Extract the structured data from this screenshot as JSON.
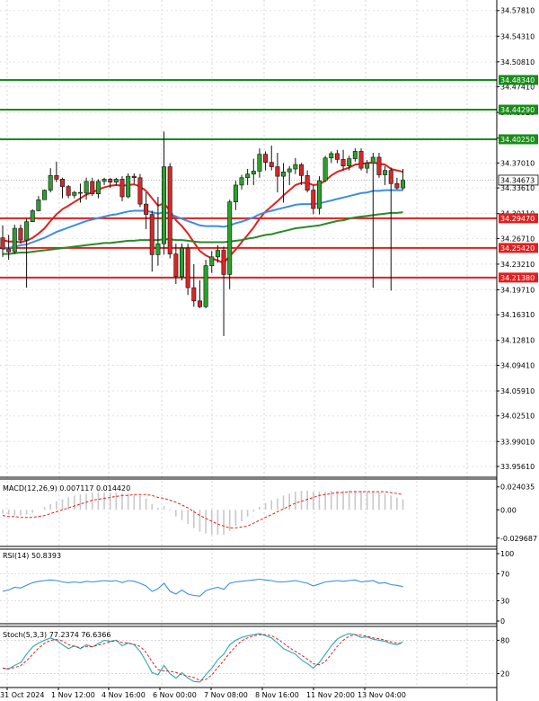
{
  "chart_data": {
    "type": "candlestick",
    "x_ticks": [
      "31 Oct 2024",
      "1 Nov 12:00",
      "4 Nov 16:00",
      "6 Nov 00:00",
      "7 Nov 08:00",
      "8 Nov 16:00",
      "11 Nov 20:00",
      "13 Nov 04:00"
    ],
    "price_axis": {
      "ylim": [
        33.9414,
        34.5925
      ],
      "ticks": [
        "34.57810",
        "34.54310",
        "34.50810",
        "34.47410",
        "34.43910",
        "34.40410",
        "34.37010",
        "34.33610",
        "34.30110",
        "34.26710",
        "34.23210",
        "34.19710",
        "34.16310",
        "34.12810",
        "34.09410",
        "34.05910",
        "34.02510",
        "33.99010",
        "33.95610"
      ]
    },
    "current_price": {
      "value": 34.34673,
      "label": "34.34673"
    },
    "levels": [
      {
        "value": 34.4834,
        "label": "34.48340",
        "role": "resistance",
        "color": "#1a8c1a"
      },
      {
        "value": 34.4429,
        "label": "34.44290",
        "role": "resistance",
        "color": "#1a8c1a"
      },
      {
        "value": 34.4025,
        "label": "34.40250",
        "role": "resistance",
        "color": "#1a8c1a"
      },
      {
        "value": 34.2947,
        "label": "34.29470",
        "role": "support",
        "color": "#e02020"
      },
      {
        "value": 34.2542,
        "label": "34.25420",
        "role": "support",
        "color": "#e02020"
      },
      {
        "value": 34.2138,
        "label": "34.21380",
        "role": "support",
        "color": "#e02020"
      }
    ],
    "candles": [
      [
        34.268,
        34.285,
        34.242,
        34.253
      ],
      [
        34.253,
        34.272,
        34.238,
        34.249
      ],
      [
        34.249,
        34.286,
        34.246,
        34.281
      ],
      [
        34.281,
        34.286,
        34.26,
        34.265
      ],
      [
        34.265,
        34.294,
        34.2,
        34.29
      ],
      [
        34.29,
        34.307,
        34.29,
        34.305
      ],
      [
        34.305,
        34.325,
        34.304,
        34.32
      ],
      [
        34.32,
        34.334,
        34.32,
        34.333
      ],
      [
        34.333,
        34.363,
        34.33,
        34.353
      ],
      [
        34.353,
        34.372,
        34.344,
        34.348
      ],
      [
        34.348,
        34.35,
        34.322,
        34.338
      ],
      [
        34.338,
        34.34,
        34.322,
        34.326
      ],
      [
        34.326,
        34.332,
        34.322,
        34.33
      ],
      [
        34.33,
        34.342,
        34.316,
        34.329
      ],
      [
        34.329,
        34.35,
        34.32,
        34.345
      ],
      [
        34.345,
        34.35,
        34.325,
        34.328
      ],
      [
        34.328,
        34.348,
        34.322,
        34.345
      ],
      [
        34.345,
        34.35,
        34.34,
        34.348
      ],
      [
        34.348,
        34.35,
        34.336,
        34.344
      ],
      [
        34.344,
        34.35,
        34.34,
        34.348
      ],
      [
        34.348,
        34.352,
        34.318,
        34.324
      ],
      [
        34.324,
        34.356,
        34.322,
        34.352
      ],
      [
        34.352,
        34.356,
        34.342,
        34.35
      ],
      [
        34.35,
        34.355,
        34.31,
        34.314
      ],
      [
        34.314,
        34.33,
        34.28,
        34.3
      ],
      [
        34.3,
        34.305,
        34.222,
        34.245
      ],
      [
        34.245,
        34.324,
        34.23,
        34.26
      ],
      [
        34.26,
        34.413,
        34.245,
        34.365
      ],
      [
        34.365,
        34.37,
        34.24,
        34.246
      ],
      [
        34.246,
        34.26,
        34.205,
        34.215
      ],
      [
        34.215,
        34.26,
        34.21,
        34.254
      ],
      [
        34.254,
        34.26,
        34.19,
        34.2
      ],
      [
        34.2,
        34.232,
        34.174,
        34.182
      ],
      [
        34.182,
        34.21,
        34.172,
        34.174
      ],
      [
        34.174,
        34.238,
        34.172,
        34.23
      ],
      [
        34.23,
        34.25,
        34.22,
        34.242
      ],
      [
        34.242,
        34.258,
        34.234,
        34.251
      ],
      [
        34.251,
        34.256,
        34.134,
        34.218
      ],
      [
        34.218,
        34.32,
        34.198,
        34.317
      ],
      [
        34.317,
        34.346,
        34.306,
        34.34
      ],
      [
        34.34,
        34.354,
        34.334,
        34.35
      ],
      [
        34.35,
        34.362,
        34.34,
        34.355
      ],
      [
        34.355,
        34.376,
        34.34,
        34.359
      ],
      [
        34.359,
        34.39,
        34.35,
        34.382
      ],
      [
        34.382,
        34.386,
        34.36,
        34.371
      ],
      [
        34.371,
        34.394,
        34.36,
        34.365
      ],
      [
        34.365,
        34.384,
        34.33,
        34.352
      ],
      [
        34.352,
        34.37,
        34.316,
        34.358
      ],
      [
        34.358,
        34.366,
        34.34,
        34.362
      ],
      [
        34.362,
        34.377,
        34.355,
        34.368
      ],
      [
        34.368,
        34.37,
        34.34,
        34.353
      ],
      [
        34.353,
        34.36,
        34.33,
        34.333
      ],
      [
        34.333,
        34.34,
        34.3,
        34.308
      ],
      [
        34.308,
        34.352,
        34.3,
        34.346
      ],
      [
        34.346,
        34.38,
        34.344,
        34.377
      ],
      [
        34.377,
        34.386,
        34.37,
        34.383
      ],
      [
        34.383,
        34.388,
        34.37,
        34.375
      ],
      [
        34.375,
        34.388,
        34.36,
        34.366
      ],
      [
        34.366,
        34.38,
        34.36,
        34.376
      ],
      [
        34.376,
        34.39,
        34.372,
        34.386
      ],
      [
        34.386,
        34.39,
        34.36,
        34.363
      ],
      [
        34.363,
        34.374,
        34.356,
        34.37
      ],
      [
        34.37,
        34.384,
        34.2,
        34.378
      ],
      [
        34.378,
        34.384,
        34.35,
        34.354
      ],
      [
        34.354,
        34.366,
        34.34,
        34.36
      ],
      [
        34.36,
        34.364,
        34.196,
        34.342
      ],
      [
        34.342,
        34.35,
        34.334,
        34.336
      ],
      [
        34.336,
        34.362,
        34.333,
        34.347
      ]
    ],
    "moving_averages": [
      {
        "color": "#e02020",
        "values": [
          34.265,
          34.263,
          34.263,
          34.262,
          34.264,
          34.268,
          34.274,
          34.281,
          34.291,
          34.3,
          34.307,
          34.312,
          34.317,
          34.322,
          34.327,
          34.33,
          34.334,
          34.337,
          34.339,
          34.34,
          34.339,
          34.34,
          34.341,
          34.338,
          34.332,
          34.322,
          34.312,
          34.315,
          34.305,
          34.292,
          34.284,
          34.274,
          34.262,
          34.25,
          34.244,
          34.24,
          34.237,
          34.234,
          34.243,
          34.252,
          34.262,
          34.272,
          34.282,
          34.294,
          34.304,
          34.311,
          34.318,
          34.326,
          34.333,
          34.34,
          34.343,
          34.343,
          34.34,
          34.341,
          34.346,
          34.353,
          34.358,
          34.361,
          34.364,
          34.368,
          34.369,
          34.37,
          34.371,
          34.369,
          34.368,
          34.362,
          34.36,
          34.358
        ]
      },
      {
        "color": "#3b8fe0",
        "values": [
          34.253,
          34.254,
          34.256,
          34.258,
          34.259,
          34.262,
          34.265,
          34.268,
          34.272,
          34.276,
          34.279,
          34.282,
          34.285,
          34.288,
          34.291,
          34.293,
          34.295,
          34.297,
          34.299,
          34.3,
          34.302,
          34.304,
          34.305,
          34.305,
          34.305,
          34.303,
          34.301,
          34.303,
          34.301,
          34.297,
          34.294,
          34.291,
          34.288,
          34.285,
          34.284,
          34.284,
          34.284,
          34.283,
          34.285,
          34.288,
          34.29,
          34.293,
          34.296,
          34.3,
          34.303,
          34.305,
          34.307,
          34.309,
          34.311,
          34.313,
          34.314,
          34.314,
          34.314,
          34.315,
          34.317,
          34.319,
          34.321,
          34.323,
          34.325,
          34.327,
          34.329,
          34.33,
          34.332,
          34.332,
          34.333,
          34.333,
          34.333,
          34.333
        ]
      },
      {
        "color": "#2a8a2a",
        "values": [
          34.246,
          34.246,
          34.247,
          34.248,
          34.248,
          34.249,
          34.25,
          34.251,
          34.252,
          34.253,
          34.254,
          34.255,
          34.256,
          34.257,
          34.258,
          34.259,
          34.26,
          34.261,
          34.261,
          34.262,
          34.263,
          34.264,
          34.264,
          34.265,
          34.265,
          34.265,
          34.265,
          34.266,
          34.266,
          34.265,
          34.265,
          34.264,
          34.263,
          34.262,
          34.262,
          34.262,
          34.262,
          34.262,
          34.263,
          34.264,
          34.265,
          34.267,
          34.268,
          34.27,
          34.272,
          34.273,
          34.275,
          34.277,
          34.279,
          34.281,
          34.282,
          34.283,
          34.284,
          34.285,
          34.287,
          34.289,
          34.291,
          34.292,
          34.294,
          34.296,
          34.297,
          34.298,
          34.299,
          34.3,
          34.301,
          34.302,
          34.302,
          34.303
        ]
      }
    ],
    "macd": {
      "label": "MACD(12,26,9) 0.007117 0.014420",
      "ylim": [
        -0.0365,
        0.0285
      ],
      "ticks": [
        "0.024035",
        "0.00",
        "-0.029687"
      ],
      "histogram": [
        -0.004,
        -0.005,
        -0.006,
        -0.006,
        -0.005,
        -0.003,
        0,
        0.003,
        0.006,
        0.009,
        0.011,
        0.013,
        0.015,
        0.016,
        0.017,
        0.018,
        0.018,
        0.018,
        0.018,
        0.018,
        0.017,
        0.017,
        0.016,
        0.015,
        0.012,
        0.006,
        0.002,
        0.004,
        -0.001,
        -0.007,
        -0.011,
        -0.015,
        -0.019,
        -0.023,
        -0.025,
        -0.026,
        -0.026,
        -0.026,
        -0.022,
        -0.017,
        -0.012,
        -0.007,
        -0.002,
        0.003,
        0.007,
        0.01,
        0.012,
        0.015,
        0.017,
        0.019,
        0.02,
        0.02,
        0.019,
        0.019,
        0.019,
        0.02,
        0.02,
        0.02,
        0.02,
        0.02,
        0.02,
        0.019,
        0.019,
        0.018,
        0.017,
        0.015,
        0.013,
        0.011
      ],
      "signal": [
        -0.006,
        -0.007,
        -0.007,
        -0.008,
        -0.008,
        -0.008,
        -0.007,
        -0.006,
        -0.004,
        -0.002,
        0,
        0.002,
        0.004,
        0.006,
        0.008,
        0.01,
        0.011,
        0.012,
        0.013,
        0.014,
        0.015,
        0.015,
        0.016,
        0.016,
        0.016,
        0.015,
        0.013,
        0.012,
        0.01,
        0.008,
        0.005,
        0.002,
        -0.002,
        -0.006,
        -0.009,
        -0.012,
        -0.015,
        -0.017,
        -0.019,
        -0.019,
        -0.018,
        -0.017,
        -0.014,
        -0.011,
        -0.008,
        -0.005,
        -0.002,
        0.001,
        0.004,
        0.007,
        0.009,
        0.011,
        0.013,
        0.015,
        0.016,
        0.017,
        0.018,
        0.018,
        0.019,
        0.019,
        0.019,
        0.019,
        0.019,
        0.019,
        0.019,
        0.018,
        0.017,
        0.016
      ]
    },
    "rsi": {
      "label": "RSI(14) 50.8393",
      "ylim": [
        0,
        100
      ],
      "ticks": [
        "100",
        "70",
        "30",
        "0"
      ],
      "values": [
        44,
        46,
        50,
        49,
        53,
        57,
        59,
        60,
        61,
        60,
        58,
        57,
        58,
        57,
        59,
        58,
        59,
        60,
        59,
        60,
        57,
        60,
        59,
        56,
        52,
        44,
        48,
        56,
        44,
        40,
        46,
        40,
        38,
        37,
        45,
        48,
        50,
        47,
        56,
        58,
        59,
        60,
        61,
        62,
        61,
        60,
        58,
        58,
        59,
        60,
        58,
        56,
        52,
        55,
        58,
        59,
        60,
        59,
        60,
        61,
        58,
        59,
        60,
        56,
        57,
        54,
        53,
        51
      ]
    },
    "stoch": {
      "label": "Stoch(5,3,3) 77.2374 76.6366",
      "ylim": [
        0,
        100
      ],
      "ticks": [
        "80",
        "20"
      ],
      "k": [
        30,
        28,
        35,
        40,
        55,
        68,
        75,
        80,
        84,
        80,
        72,
        65,
        70,
        65,
        72,
        68,
        74,
        80,
        78,
        80,
        70,
        75,
        72,
        60,
        42,
        22,
        18,
        35,
        20,
        12,
        22,
        12,
        6,
        5,
        18,
        30,
        45,
        55,
        72,
        80,
        85,
        88,
        90,
        92,
        88,
        84,
        75,
        65,
        60,
        55,
        45,
        38,
        30,
        40,
        55,
        70,
        82,
        88,
        92,
        90,
        85,
        86,
        82,
        80,
        78,
        74,
        72,
        77
      ]
    }
  }
}
